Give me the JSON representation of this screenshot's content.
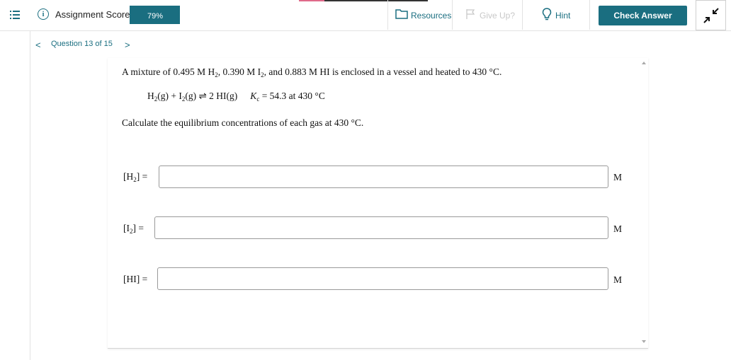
{
  "header": {
    "score_label": "Assignment Score:",
    "score_value": "79%",
    "resources_label": "Resources",
    "giveup_label": "Give Up?",
    "hint_label": "Hint",
    "check_label": "Check Answer"
  },
  "nav": {
    "prev": "<",
    "question_label": "Question 13 of 15",
    "next": ">"
  },
  "problem": {
    "intro": "A mixture of 0.495 M H",
    "intro_sub1": "2",
    "intro_mid1": ", 0.390 M I",
    "intro_sub2": "2",
    "intro_end": ", and 0.883 M HI is enclosed in a vessel and heated to 430 °C.",
    "eq_part1": "H",
    "eq_sub1": "2",
    "eq_part2": "(g) + I",
    "eq_sub2": "2",
    "eq_part3": "(g)",
    "eq_arrow": "⇌",
    "eq_part4": "2 HI(g)",
    "kc_symbol": "K",
    "kc_sub": "c",
    "kc_value": "= 54.3 at 430 °C",
    "instruction": "Calculate the equilibrium concentrations of each gas at 430 °C."
  },
  "answers": [
    {
      "label_main": "[H",
      "label_sub": "2",
      "label_end": "] =",
      "value": "",
      "unit": "M"
    },
    {
      "label_main": "[I",
      "label_sub": "2",
      "label_end": "] =",
      "value": "",
      "unit": "M"
    },
    {
      "label_main": "[HI]",
      "label_sub": "",
      "label_end": " =",
      "value": "",
      "unit": "M"
    }
  ],
  "colors": {
    "accent": "#1a6e80",
    "progress_segment": "#e06a8a"
  }
}
